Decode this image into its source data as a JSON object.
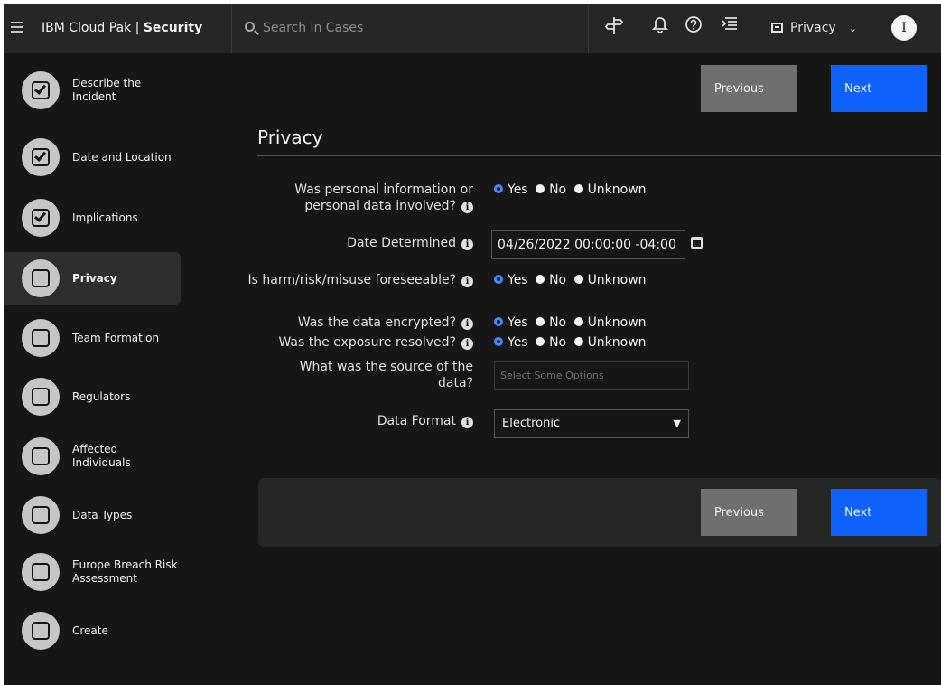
{
  "header": {
    "brand_prefix": "IBM Cloud Pak | ",
    "brand_product": "Security",
    "search_placeholder": "Search in Cases",
    "icons": [
      "menu-icon",
      "search-icon",
      "signpost-icon",
      "notification-icon",
      "help-icon",
      "task-list-icon",
      "switcher-icon",
      "chevron-down-icon"
    ],
    "switcher_label": "Privacy",
    "avatar_initial": "I"
  },
  "sidebar": {
    "steps": [
      {
        "label": "Describe the Incident",
        "completed": true
      },
      {
        "label": "Date and Location",
        "completed": true
      },
      {
        "label": "Implications",
        "completed": true
      },
      {
        "label": "Privacy",
        "completed": false,
        "active": true
      },
      {
        "label": "Team Formation",
        "completed": false
      },
      {
        "label": "Regulators",
        "completed": false
      },
      {
        "label": "Affected Individuals",
        "completed": false
      },
      {
        "label": "Data Types",
        "completed": false
      },
      {
        "label": "Europe Breach Risk Assessment",
        "completed": false
      },
      {
        "label": "Create",
        "completed": false
      }
    ]
  },
  "nav": {
    "previous_label": "Previous",
    "next_label": "Next"
  },
  "form": {
    "title": "Privacy",
    "radio_options": {
      "yes": "Yes",
      "no": "No",
      "unknown": "Unknown"
    },
    "q_personal": {
      "label": "Was personal information or personal data involved?",
      "selected": "Yes"
    },
    "date_determined": {
      "label": "Date Determined",
      "value": "04/26/2022 00:00:00 -04:00"
    },
    "q_harm": {
      "label": "Is harm/risk/misuse foreseeable?",
      "selected": "Yes"
    },
    "q_encrypted": {
      "label": "Was the data encrypted?",
      "selected": "Yes"
    },
    "q_resolved": {
      "label": "Was the exposure resolved?",
      "selected": "Yes"
    },
    "source": {
      "label": "What was the source of the data?",
      "placeholder": "Select Some Options"
    },
    "data_format": {
      "label": "Data Format",
      "value": "Electronic"
    }
  },
  "colors": {
    "accent": "#0f62fe",
    "radio_selected": "#4589ff",
    "background": "#161616",
    "header": "#262626",
    "secondary_button": "#6f6f6f"
  }
}
